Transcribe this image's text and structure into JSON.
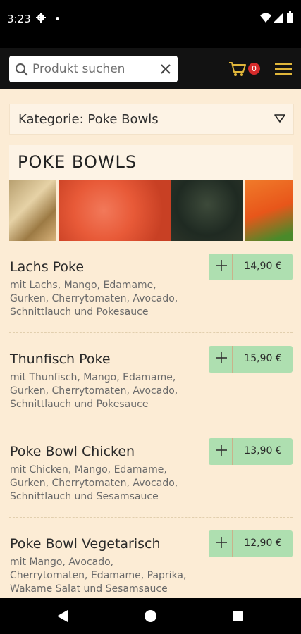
{
  "status_bar": {
    "time": "3:23"
  },
  "search": {
    "placeholder": "Produkt suchen"
  },
  "cart": {
    "count": "0"
  },
  "category": {
    "label": "Kategorie: Poke Bowls"
  },
  "section": {
    "title": "POKE BOWLS"
  },
  "items": [
    {
      "name": "Lachs Poke",
      "description": "mit Lachs, Mango, Edamame, Gurken, Cherrytomaten, Avocado, Schnittlauch und Pokesauce",
      "price": "14,90 €"
    },
    {
      "name": "Thunfisch Poke",
      "description": "mit Thunfisch, Mango, Edamame, Gurken, Cherrytomaten, Avocado, Schnittlauch und Pokesauce",
      "price": "15,90 €"
    },
    {
      "name": "Poke Bowl Chicken",
      "description": "mit Chicken, Mango, Edamame, Gurken, Cherrytomaten, Avocado, Schnittlauch und Sesamsauce",
      "price": "13,90 €"
    },
    {
      "name": "Poke Bowl Vegetarisch",
      "description": "mit Mango, Avocado, Cherrytomaten, Edamame, Paprika, Wakame Salat und Sesamsauce",
      "price": "12,90 €"
    }
  ],
  "colors": {
    "accent": "#e0b63a",
    "add_button": "#aedfb0",
    "background": "#fcecd5",
    "badge": "#d62b2b"
  }
}
